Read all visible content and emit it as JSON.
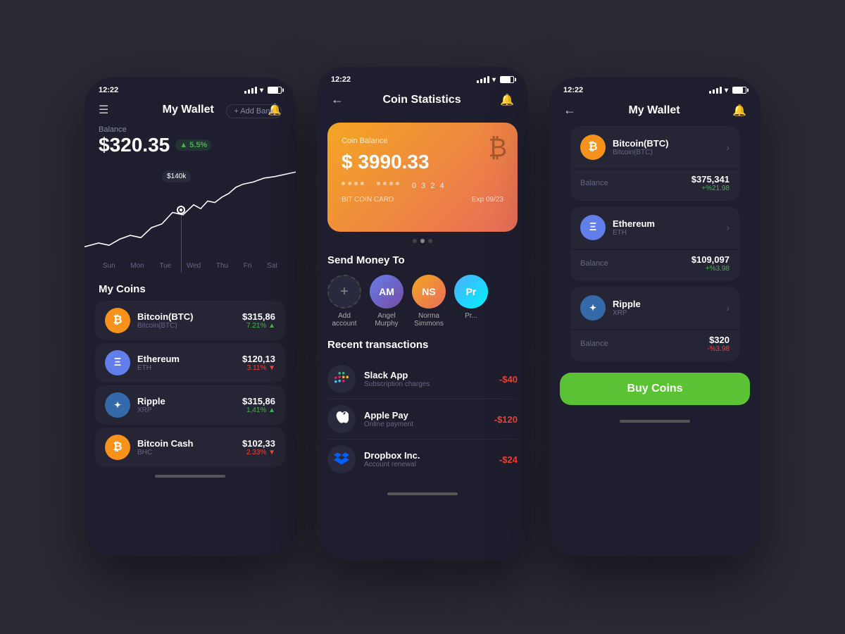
{
  "phone1": {
    "status": {
      "time": "12:22",
      "arrow": "▲"
    },
    "header": {
      "title": "My Wallet",
      "menu": "☰",
      "bell": "🔔"
    },
    "balance": {
      "label": "Balance",
      "amount": "$320.35",
      "change": "▲ 5.5%",
      "add_bank": "+ Add Bank"
    },
    "chart": {
      "label": "$140k",
      "days": [
        "Sun",
        "Mon",
        "Tue",
        "Wed",
        "Thu",
        "Fri",
        "Sat"
      ]
    },
    "my_coins_title": "My Coins",
    "coins": [
      {
        "name": "Bitcoin(BTC)",
        "sub": "Bitcoin(BTC)",
        "price": "$315,86",
        "change": "7.21%",
        "up": true,
        "color": "btc"
      },
      {
        "name": "Ethereum",
        "sub": "ETH",
        "price": "$120,13",
        "change": "3.11%",
        "up": false,
        "color": "eth"
      },
      {
        "name": "Ripple",
        "sub": "XRP",
        "price": "$315,86",
        "change": "1,41%",
        "up": true,
        "color": "xrp"
      },
      {
        "name": "Bitcoin Cash",
        "sub": "BHC",
        "price": "$102,33",
        "change": "2.33%",
        "up": false,
        "color": "bhc"
      }
    ]
  },
  "phone2": {
    "status": {
      "time": "12:22"
    },
    "header": {
      "title": "Coin Statistics",
      "bell": "🔔"
    },
    "card": {
      "label": "Coin Balance",
      "amount": "$ 3990.33",
      "dots": "• • • •   • • • •   0 3 2 4",
      "card_name": "BIT COIN CARD",
      "exp": "Exp 09/23"
    },
    "send_title": "Send Money To",
    "contacts": [
      {
        "name": "Add\naccount",
        "type": "add"
      },
      {
        "name": "Angel\nMurphy",
        "type": "angel"
      },
      {
        "name": "Norma\nSimmons",
        "type": "norma"
      },
      {
        "name": "Pr...",
        "type": "pr"
      }
    ],
    "transactions_title": "Recent transactions",
    "transactions": [
      {
        "name": "Slack App",
        "desc": "Subscription charges",
        "amount": "-$40",
        "icon": "slack"
      },
      {
        "name": "Apple Pay",
        "desc": "Online payment",
        "amount": "-$120",
        "icon": "apple"
      },
      {
        "name": "Dropbox Inc.",
        "desc": "Account renewal",
        "amount": "-$24",
        "icon": "dropbox"
      }
    ]
  },
  "phone3": {
    "status": {
      "time": "12:22"
    },
    "header": {
      "title": "My Wallet",
      "bell": "🔔"
    },
    "wallet_coins": [
      {
        "name": "Bitcoin(BTC)",
        "sub": "Bitcoin(BTC)",
        "color": "btc",
        "balance_label": "Balance",
        "balance": "$375,341",
        "change": "+%21.98",
        "up": true
      },
      {
        "name": "Ethereum",
        "sub": "ETH",
        "color": "eth",
        "balance_label": "Balance",
        "balance": "$109,097",
        "change": "+%3.98",
        "up": true
      },
      {
        "name": "Ripple",
        "sub": "XRP",
        "color": "xrp",
        "balance_label": "Balance",
        "balance": "$320",
        "change": "-%3.98",
        "up": false
      }
    ],
    "buy_btn": "Buy Coins"
  }
}
